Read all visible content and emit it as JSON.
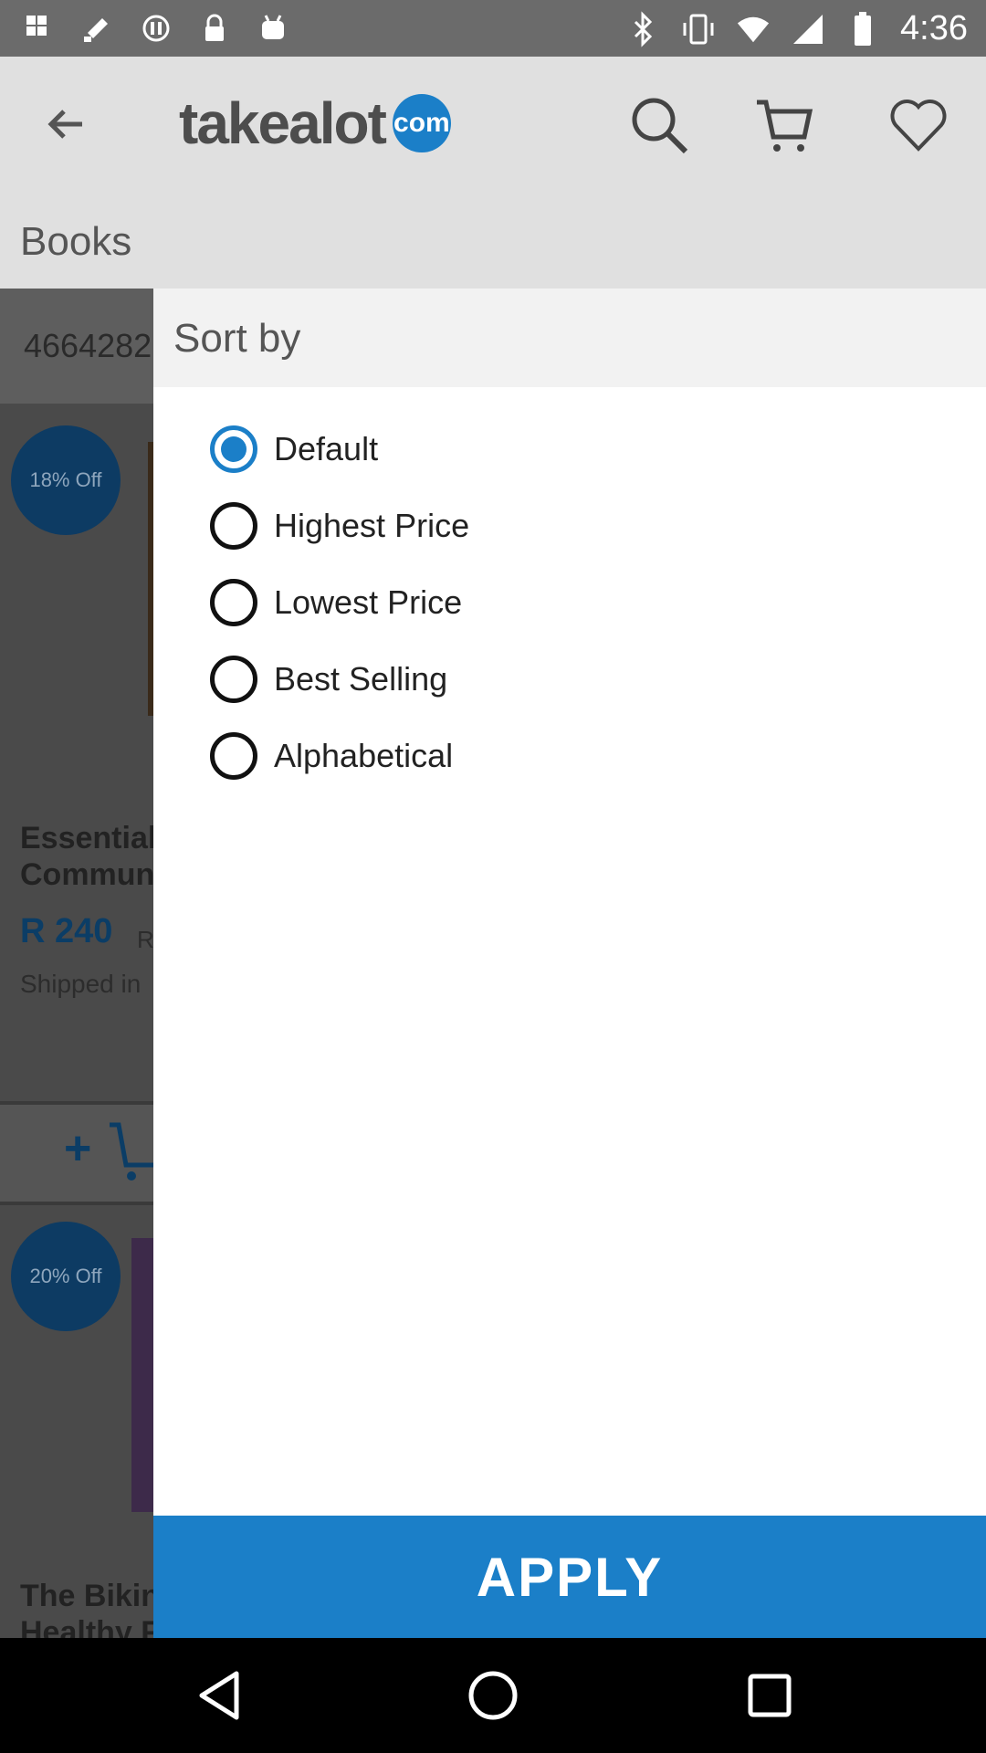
{
  "status_bar": {
    "time": "4:36",
    "left_icons": [
      "fake-gps-icon",
      "satellite-icon",
      "sync-icon",
      "lock-icon",
      "android-icon"
    ],
    "right_icons": [
      "bluetooth-icon",
      "vibrate-icon",
      "wifi-icon",
      "signal-icon",
      "battery-icon"
    ]
  },
  "header": {
    "logo_text": "takealot",
    "logo_badge": "com",
    "icons": [
      "back-arrow-icon",
      "search-icon",
      "cart-icon",
      "heart-icon"
    ]
  },
  "category": {
    "title": "Books"
  },
  "background_list": {
    "result_count": "4664282",
    "items": [
      {
        "badge": "18% Off",
        "title_line1": "Essential",
        "title_line2": "Commun",
        "price": "R 240",
        "old_price": "R",
        "shipping": "Shipped in"
      },
      {
        "badge": "20% Off",
        "title_line1": "The Bikin",
        "title_line2": "Healthy F"
      }
    ]
  },
  "sort_panel": {
    "title": "Sort by",
    "options": [
      {
        "label": "Default",
        "selected": true
      },
      {
        "label": "Highest Price",
        "selected": false
      },
      {
        "label": "Lowest Price",
        "selected": false
      },
      {
        "label": "Best Selling",
        "selected": false
      },
      {
        "label": "Alphabetical",
        "selected": false
      }
    ],
    "apply_label": "APPLY"
  },
  "colors": {
    "accent": "#1b7fc8",
    "badge": "#0d3b63",
    "header_bg": "#e0e0e0"
  },
  "nav_bar": {
    "icons": [
      "back-icon",
      "home-icon",
      "recents-icon"
    ]
  }
}
